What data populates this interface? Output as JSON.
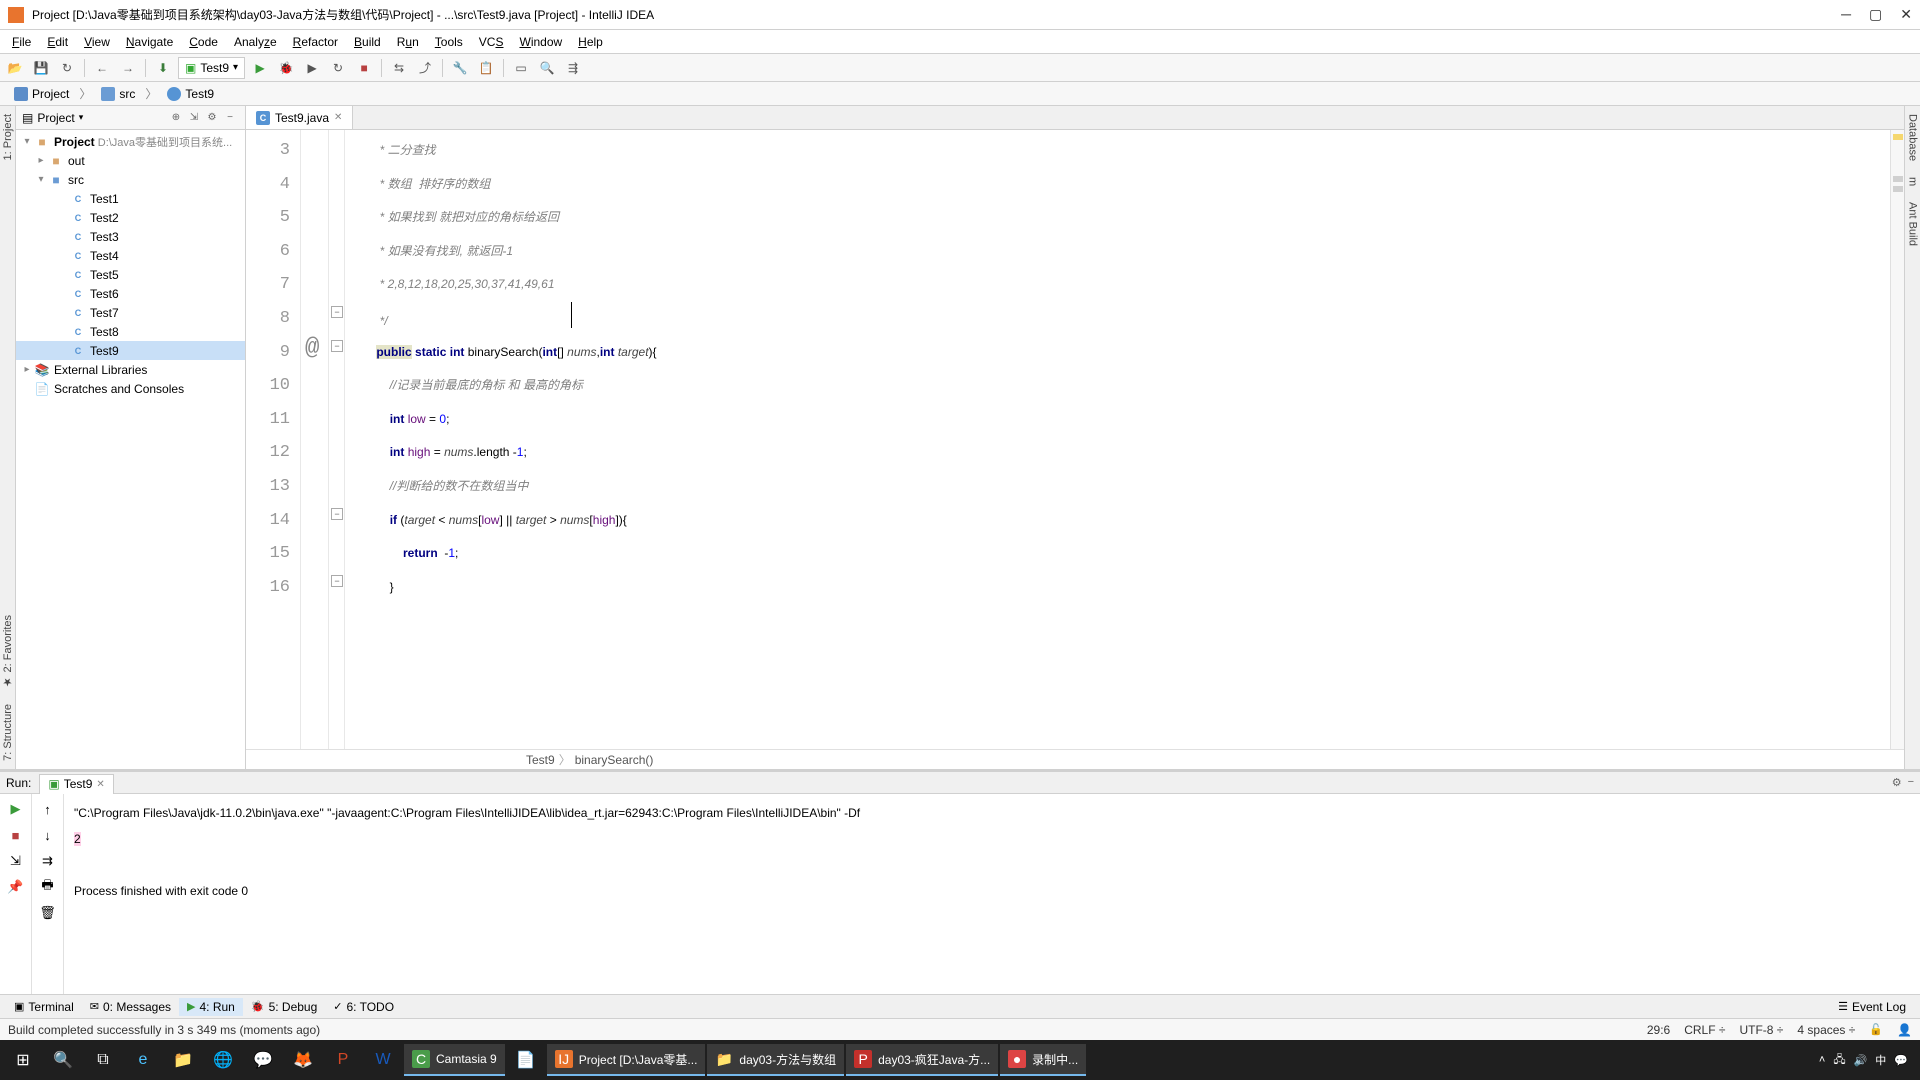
{
  "titlebar": {
    "title": "Project [D:\\Java零基础到项目系统架构\\day03-Java方法与数组\\代码\\Project] - ...\\src\\Test9.java [Project] - IntelliJ IDEA"
  },
  "menubar": [
    "File",
    "Edit",
    "View",
    "Navigate",
    "Code",
    "Analyze",
    "Refactor",
    "Build",
    "Run",
    "Tools",
    "VCS",
    "Window",
    "Help"
  ],
  "run_config": "Test9",
  "navbar": [
    "Project",
    "src",
    "Test9"
  ],
  "project": {
    "title": "Project",
    "root": "Project",
    "root_path": "D:\\Java零基础到项目系统...",
    "out": "out",
    "src": "src",
    "files": [
      "Test1",
      "Test2",
      "Test3",
      "Test4",
      "Test5",
      "Test6",
      "Test7",
      "Test8",
      "Test9"
    ],
    "ext_libs": "External Libraries",
    "scratches": "Scratches and Consoles"
  },
  "editor": {
    "tab": "Test9.java",
    "line_numbers": [
      3,
      4,
      5,
      6,
      7,
      8,
      9,
      10,
      11,
      12,
      13,
      14,
      15,
      16
    ],
    "lines": {
      "l3": "        * 二分查找",
      "l4": "        * 数组  排好序的数组",
      "l5": "        * 如果找到 就把对应的角标给返回",
      "l6": "        * 如果没有找到, 就返回-1",
      "l7": "        * 2,8,12,18,20,25,30,37,41,49,61",
      "l8": "        */",
      "l10": "           //记录当前最底的角标 和 最高的角标",
      "l13": "           //判断给的数不在数组当中"
    }
  },
  "breadcrumb": [
    "Test9",
    "binarySearch()"
  ],
  "run_panel": {
    "title": "Run:",
    "tab": "Test9",
    "out_cmd": "\"C:\\Program Files\\Java\\jdk-11.0.2\\bin\\java.exe\" \"-javaagent:C:\\Program Files\\IntelliJIDEA\\lib\\idea_rt.jar=62943:C:\\Program Files\\IntelliJIDEA\\bin\" -Df",
    "out_val": "2",
    "out_exit": "Process finished with exit code 0"
  },
  "bottom_tools": {
    "terminal": "Terminal",
    "messages": "0: Messages",
    "run": "4: Run",
    "debug": "5: Debug",
    "todo": "6: TODO",
    "eventlog": "Event Log"
  },
  "status": {
    "msg": "Build completed successfully in 3 s 349 ms (moments ago)",
    "pos": "29:6",
    "crlf": "CRLF",
    "enc": "UTF-8",
    "sp": "4 spaces"
  },
  "taskbar": {
    "apps": {
      "camtasia": "Camtasia 9",
      "project": "Project [D:\\Java零基...",
      "day03": "day03-方法与数组",
      "day03pdf": "day03-疯狂Java-方...",
      "record": "录制中..."
    }
  }
}
